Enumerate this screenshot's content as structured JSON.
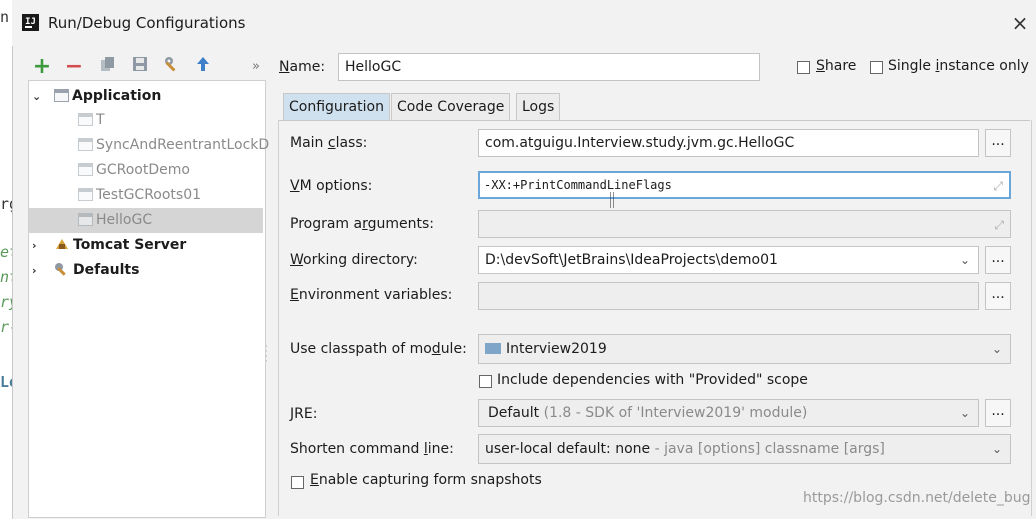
{
  "background_editor": {
    "fragments": [
      "n.",
      "rg",
      "et",
      "nt",
      "ry",
      "r-",
      "Lo"
    ]
  },
  "window": {
    "title": "Run/Debug Configurations",
    "app_icon_text": "IJ",
    "close_glyph": "×"
  },
  "toolbar": {
    "add": "+",
    "remove": "−",
    "more": "»"
  },
  "tree": {
    "application": "Application",
    "children": [
      "T",
      "SyncAndReentrantLockD",
      "GCRootDemo",
      "TestGCRoots01",
      "HelloGC"
    ],
    "tomcat": "Tomcat Server",
    "defaults": "Defaults"
  },
  "header": {
    "name_label_u": "N",
    "name_label_rest": "ame:",
    "name_value": "HelloGC",
    "share_u": "S",
    "share_rest": "hare",
    "single_pre": "Single ",
    "single_u": "i",
    "single_rest": "nstance only"
  },
  "tabs": [
    "Configuration",
    "Code Coverage",
    "Logs"
  ],
  "form": {
    "main_class_pre": "Main ",
    "main_class_u": "c",
    "main_class_rest": "lass:",
    "main_class_value": "com.atguigu.Interview.study.jvm.gc.HelloGC",
    "vm_u": "V",
    "vm_rest": "M options:",
    "vm_value": "-XX:+PrintCommandLineFlags",
    "program_pre": "Program a",
    "program_u": "r",
    "program_rest": "guments:",
    "program_value": "",
    "workdir_u": "W",
    "workdir_rest": "orking directory:",
    "workdir_value": "D:\\devSoft\\JetBrains\\IdeaProjects\\demo01",
    "env_u": "E",
    "env_rest": "nvironment variables:",
    "env_value": "",
    "classpath_pre": "Use classpath of mo",
    "classpath_u": "d",
    "classpath_rest": "ule:",
    "classpath_value": "Interview2019",
    "include_deps": "Include dependencies with \"Provided\" scope",
    "jre_u": "J",
    "jre_rest": "RE:",
    "jre_value_main": "Default",
    "jre_value_muted": " (1.8 - SDK of 'Interview2019' module)",
    "shorten_pre": "Shorten command ",
    "shorten_u": "l",
    "shorten_rest": "ine:",
    "shorten_value_main": "user-local default: none",
    "shorten_value_muted": " - java [options] classname [args]",
    "snapshots_u": "E",
    "snapshots_rest": "nable capturing form snapshots",
    "dots": "..."
  },
  "watermark": "https://blog.csdn.net/delete_bug",
  "colors": {
    "accent_tab": "#cfe0ee",
    "focus_border": "#6aa6d9",
    "add_icon": "#3c9a3c",
    "remove_icon": "#d24d4d"
  }
}
